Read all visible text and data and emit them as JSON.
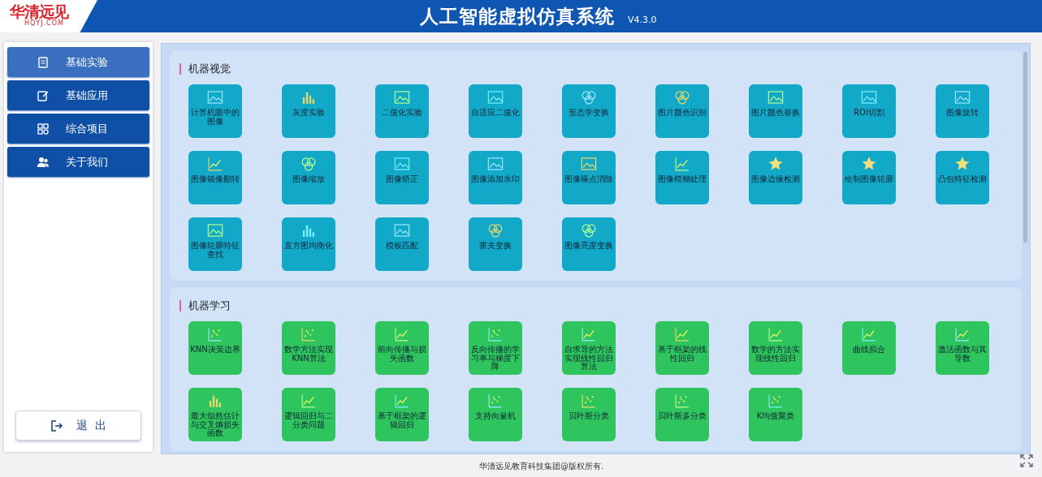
{
  "header": {
    "logo_text": "华清远见",
    "logo_sub": "HQYJ.COM",
    "title": "人工智能虚拟仿真系统",
    "version": "V4.3.0"
  },
  "sidebar": {
    "items": [
      {
        "label": "基础实验",
        "selected": true
      },
      {
        "label": "基础应用",
        "selected": false
      },
      {
        "label": "综合项目",
        "selected": false
      },
      {
        "label": "关于我们",
        "selected": false
      }
    ],
    "exit_button": "退  出"
  },
  "sections": [
    {
      "title": "机器视觉",
      "color": "#12a9c9",
      "tiles": [
        {
          "label": "计算机眼中的图像"
        },
        {
          "label": "灰度实验"
        },
        {
          "label": "二值化实验"
        },
        {
          "label": "自适应二值化"
        },
        {
          "label": "形态学变换"
        },
        {
          "label": "图片颜色识别"
        },
        {
          "label": "图片颜色替换"
        },
        {
          "label": "ROI切割"
        },
        {
          "label": "图像旋转"
        },
        {
          "label": "图像镜像翻转"
        },
        {
          "label": "图像缩放"
        },
        {
          "label": "图像矫正"
        },
        {
          "label": "图像添加水印"
        },
        {
          "label": "图像噪点消除"
        },
        {
          "label": "图像模糊处理"
        },
        {
          "label": "图像边缘检测"
        },
        {
          "label": "绘制图像轮廓"
        },
        {
          "label": "凸包特征检测"
        },
        {
          "label": "图像轮廓特征查找"
        },
        {
          "label": "直方图均衡化"
        },
        {
          "label": "模板匹配"
        },
        {
          "label": "霍夫变换"
        },
        {
          "label": "图像亮度变换"
        }
      ]
    },
    {
      "title": "机器学习",
      "color": "#2ec55e",
      "tiles": [
        {
          "label": "KNN决策边界"
        },
        {
          "label": "数学方法实现KNN算法"
        },
        {
          "label": "前向传播与损失函数"
        },
        {
          "label": "反向传播的学习率与梯度下降"
        },
        {
          "label": "自求导的方法实现线性回归算法"
        },
        {
          "label": "基于框架的线性回归"
        },
        {
          "label": "数学的方法实现线性回归"
        },
        {
          "label": "曲线拟合"
        },
        {
          "label": "激活函数与其导数"
        },
        {
          "label": "最大似然估计与交叉熵损失函数"
        },
        {
          "label": "逻辑回归与二分类问题"
        },
        {
          "label": "基于框架的逻辑回归"
        },
        {
          "label": "支持向量机"
        },
        {
          "label": "贝叶斯分类"
        },
        {
          "label": "贝叶斯多分类"
        },
        {
          "label": "K均值聚类"
        }
      ]
    }
  ],
  "footer": "华清远见教育科技集团@版权所有."
}
